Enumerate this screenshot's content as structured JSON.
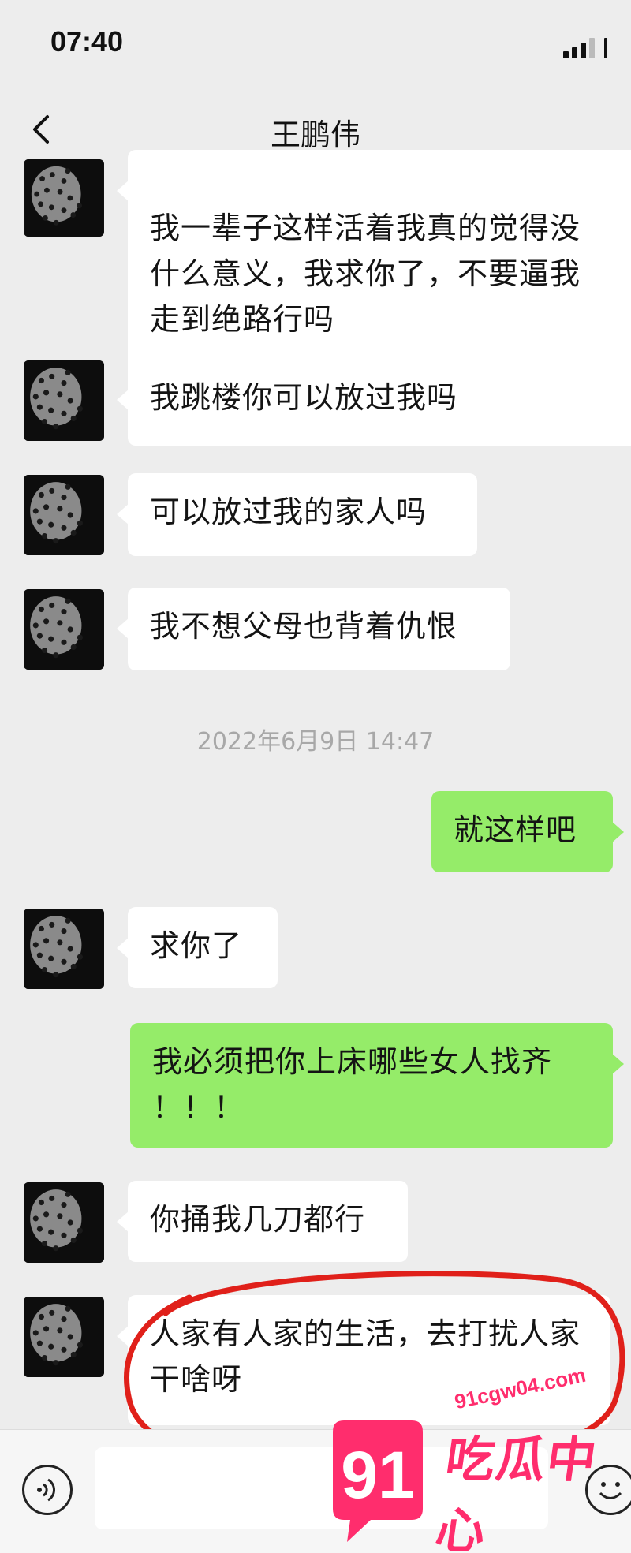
{
  "status_bar": {
    "time": "07:40"
  },
  "nav": {
    "title": "王鹏伟",
    "back_icon": "chevron-left-icon"
  },
  "messages": [
    {
      "side": "left",
      "lines": [
        "我一辈子这样活着我真的觉得没",
        "什么意义，我求你了，不要逼我",
        "走到绝路行吗"
      ]
    },
    {
      "side": "left",
      "lines": [
        "我跳楼你可以放过我吗"
      ]
    },
    {
      "side": "left",
      "lines": [
        "可以放过我的家人吗"
      ]
    },
    {
      "side": "left",
      "lines": [
        "我不想父母也背着仇恨"
      ]
    },
    {
      "side": "right",
      "lines": [
        "就这样吧"
      ]
    },
    {
      "side": "left",
      "lines": [
        "求你了"
      ]
    },
    {
      "side": "right",
      "lines": [
        "我必须把你上床哪些女人找齐",
        "！！！"
      ]
    },
    {
      "side": "left",
      "lines": [
        "你捅我几刀都行"
      ]
    },
    {
      "side": "left",
      "lines": [
        "人家有人家的生活，去打扰人家",
        "干啥呀"
      ]
    }
  ],
  "timestamp": "2022年6月9日 14:47",
  "input_bar": {
    "voice_icon": "voice-icon",
    "emoji_icon": "emoji-icon",
    "input_value": ""
  },
  "watermark": {
    "url": "91cgw04.com",
    "badge": "91",
    "name": "吃瓜中心"
  },
  "colors": {
    "background": "#ededed",
    "bubble_left": "#ffffff",
    "bubble_right": "#95ec69",
    "annotation": "#e0201a",
    "watermark": "#ff2d6d"
  }
}
